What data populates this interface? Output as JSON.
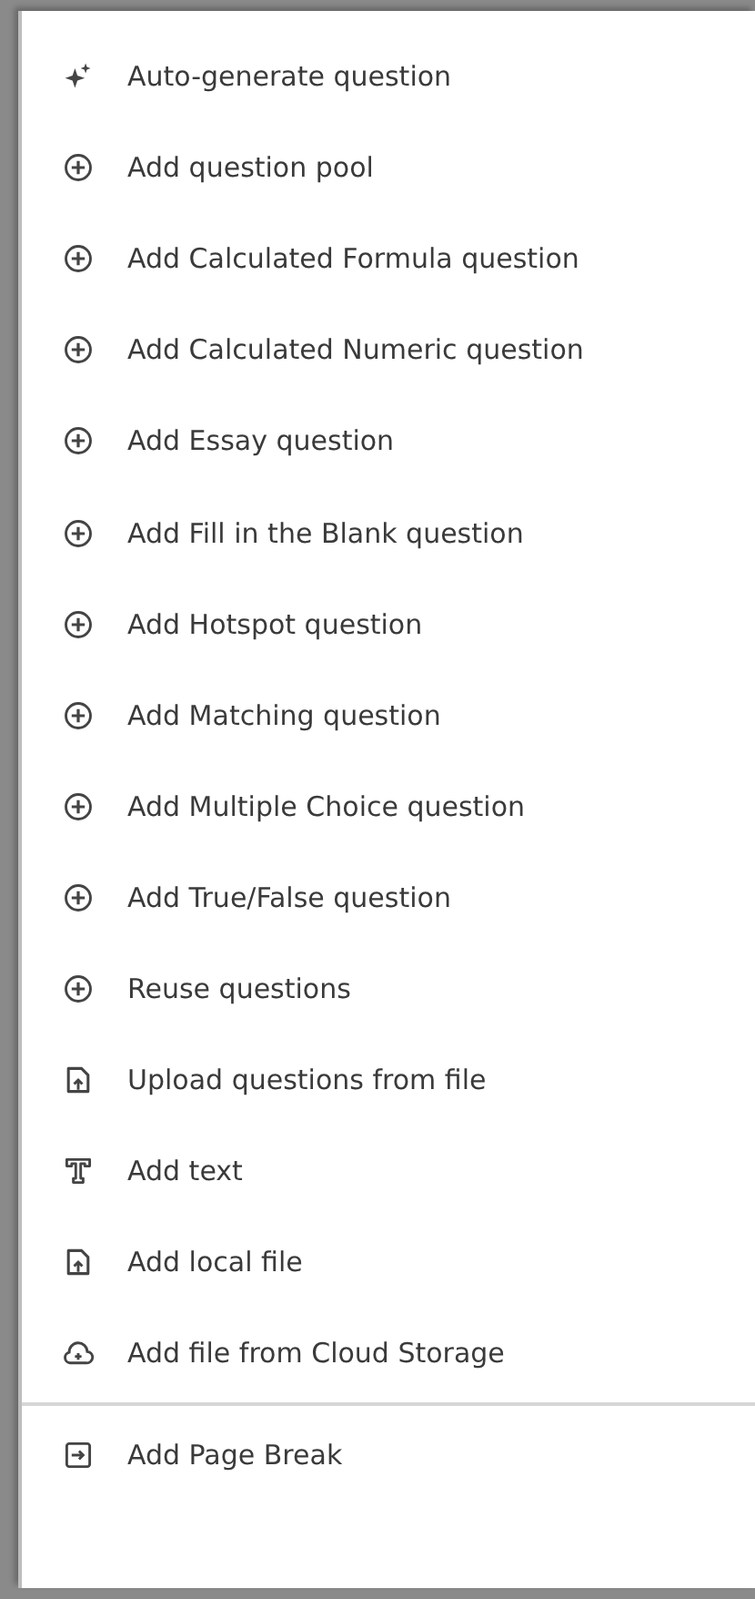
{
  "menu": {
    "sections": [
      {
        "items": [
          {
            "kind": "sparkle",
            "label": "Auto-generate question"
          },
          {
            "kind": "plus",
            "label": "Add question pool"
          },
          {
            "kind": "plus",
            "label": "Add Calculated Formula question"
          },
          {
            "kind": "plus",
            "label": "Add Calculated Numeric question"
          },
          {
            "kind": "plus",
            "label": "Add Essay question"
          },
          {
            "kind": "plus",
            "label": "Add Fill in the Blank question"
          },
          {
            "kind": "plus",
            "label": "Add Hotspot question"
          },
          {
            "kind": "plus",
            "label": "Add Matching question"
          },
          {
            "kind": "plus",
            "label": "Add Multiple Choice question"
          },
          {
            "kind": "plus",
            "label": "Add True/False question"
          },
          {
            "kind": "plus",
            "label": "Reuse questions"
          },
          {
            "kind": "upload",
            "label": "Upload questions from file"
          },
          {
            "kind": "text",
            "label": "Add text"
          },
          {
            "kind": "upload",
            "label": "Add local file"
          },
          {
            "kind": "cloud",
            "label": "Add file from Cloud Storage"
          }
        ]
      },
      {
        "items": [
          {
            "kind": "pagebreak",
            "label": "Add Page Break"
          }
        ]
      }
    ]
  }
}
